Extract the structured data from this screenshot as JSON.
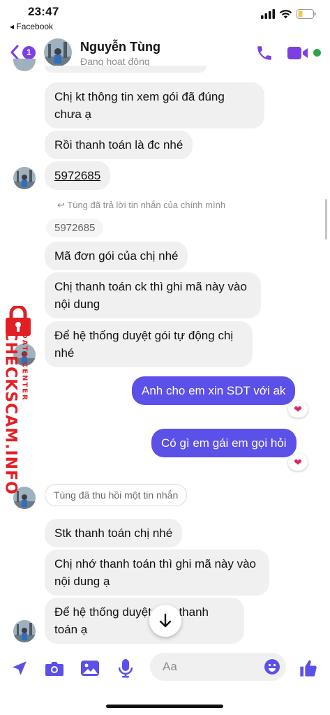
{
  "status_bar": {
    "time": "23:47",
    "back_app": "◂ Facebook"
  },
  "header": {
    "back_badge": "1",
    "name": "Nguyễn Tùng",
    "status": "Đang hoạt động"
  },
  "messages": {
    "m1": "Chị kt thông tin xem gói đã đúng chưa ạ",
    "m2": "Rồi thanh toán là đc nhé",
    "m3": "5972685",
    "reply_note": "Tùng đã trả lời tin nhắn của chính mình",
    "quoted": "5972685",
    "m4": "Mã đơn gói của chị nhé",
    "m5": "Chị thanh toán ck thì ghi mã này vào nội dung",
    "m6": "Để hệ thống duyệt gói tự động chị nhé",
    "me1": "Anh cho em xin SDT với ak",
    "me2": "Có gì em gái em gọi hỏi",
    "recall": "Tùng đã thu hồi một tin nhắn",
    "m7": "Stk thanh toán chị nhé",
    "m8": "Chị nhớ thanh toán thì ghi mã này vào nội dung ạ",
    "m9": "Để hệ thống duyệt đơn thanh toán ạ"
  },
  "watermark": {
    "brand": "CHECKSCAM.INFO",
    "sub": "DATA CENTER"
  },
  "composer": {
    "placeholder": "Aa"
  },
  "colors": {
    "accent": "#7b3fe4",
    "my_bubble": "#5b50e8",
    "online": "#31a24c",
    "watermark": "#e31f26"
  }
}
